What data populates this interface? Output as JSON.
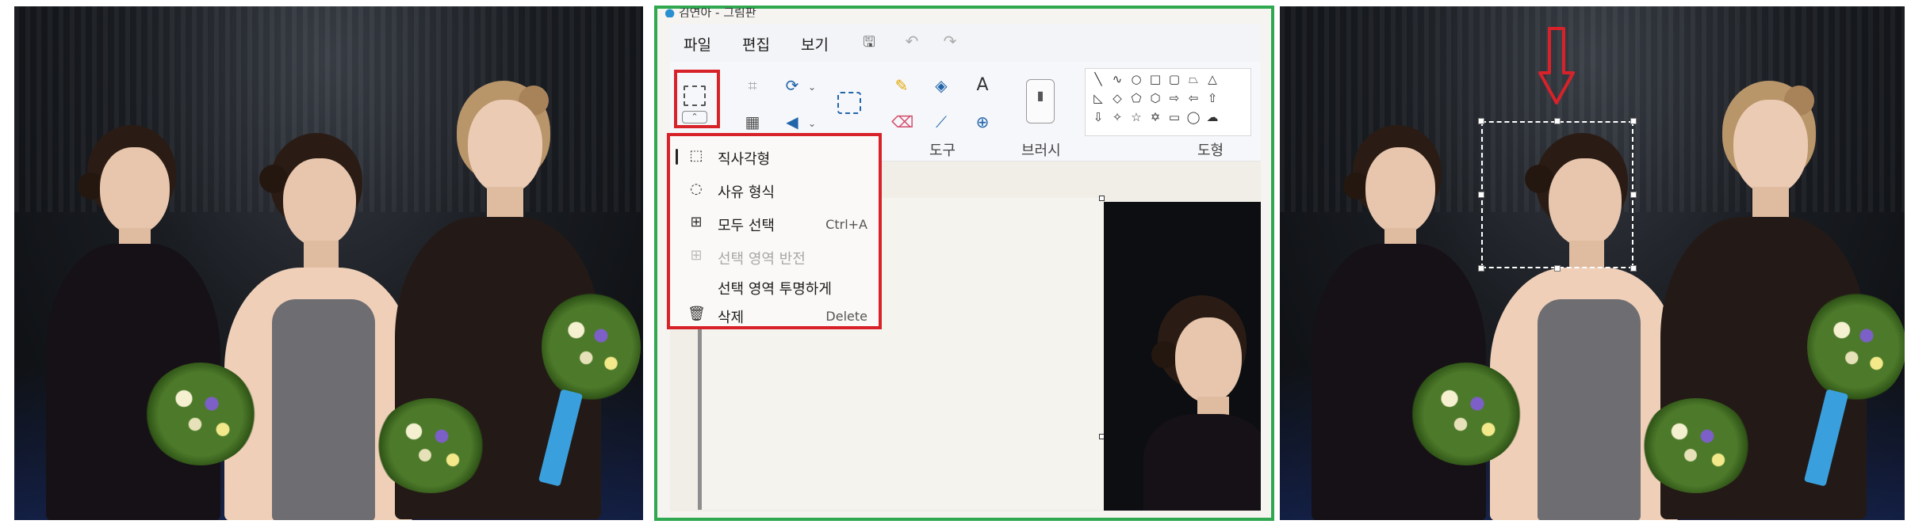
{
  "app": {
    "title_bar": "김연아 - 그림판"
  },
  "menu": {
    "file": "파일",
    "edit": "편집",
    "view": "보기"
  },
  "ribbon": {
    "tools_label": "도구",
    "brushes_label": "브러시",
    "shapes_label": "도형",
    "text_tool_glyph": "A"
  },
  "selection_menu": {
    "items": [
      {
        "label": "직사각형",
        "icon": "rect-select-icon",
        "shortcut": "",
        "disabled": false
      },
      {
        "label": "사유 형식",
        "icon": "free-form-select-icon",
        "shortcut": "",
        "disabled": false
      },
      {
        "label": "모두 선택",
        "icon": "select-all-icon",
        "shortcut": "Ctrl+A",
        "disabled": false
      },
      {
        "label": "선택 영역 반전",
        "icon": "invert-selection-icon",
        "shortcut": "",
        "disabled": true
      },
      {
        "label": "선택 영역 투명하게",
        "icon": "",
        "shortcut": "",
        "disabled": false
      },
      {
        "label": "삭제",
        "icon": "trash-icon",
        "shortcut": "Delete",
        "disabled": false
      }
    ]
  },
  "colors": {
    "highlight_red": "#d8222a",
    "frame_green": "#2fa84f"
  }
}
